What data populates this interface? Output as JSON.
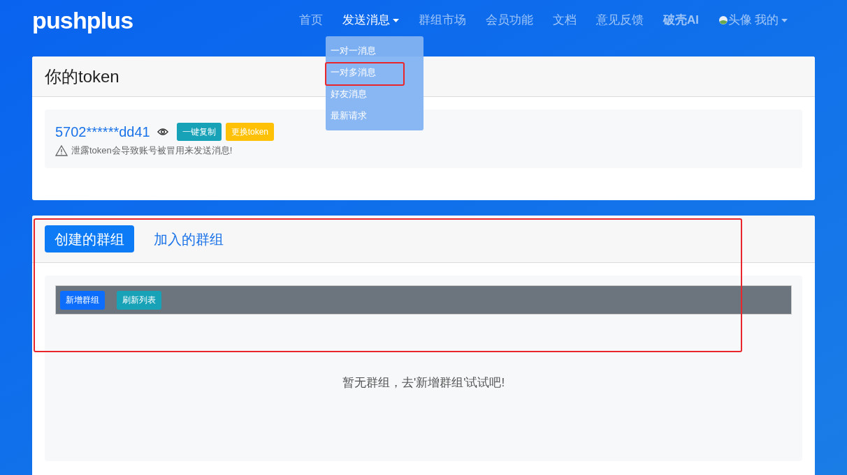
{
  "navbar": {
    "brand": "pushplus",
    "items": [
      {
        "label": "首页",
        "selected": false,
        "dropdown": false
      },
      {
        "label": "发送消息",
        "selected": true,
        "dropdown": true
      },
      {
        "label": "群组市场",
        "selected": false,
        "dropdown": false
      },
      {
        "label": "会员功能",
        "selected": false,
        "dropdown": false
      },
      {
        "label": "文档",
        "selected": false,
        "dropdown": false
      },
      {
        "label": "意见反馈",
        "selected": false,
        "dropdown": false
      },
      {
        "label": "破壳AI",
        "selected": false,
        "dropdown": false,
        "bold": true
      }
    ],
    "user": {
      "avatar_alt": "头像",
      "label": "我的"
    }
  },
  "dropdown_menu": [
    {
      "label": "一对一消息",
      "highlighted": false
    },
    {
      "label": "一对多消息",
      "highlighted": true
    },
    {
      "label": "好友消息",
      "highlighted": false
    },
    {
      "label": "最新请求",
      "highlighted": false
    }
  ],
  "token_card": {
    "title": "你的token",
    "token": "5702******dd41",
    "buttons": [
      {
        "label": "一键复制",
        "kind": "info"
      },
      {
        "label": "更换token",
        "kind": "warning"
      }
    ],
    "warning": "泄露token会导致账号被冒用来发送消息!"
  },
  "groups_card": {
    "highlighted": true,
    "tabs": [
      {
        "label": "创建的群组",
        "selected": true
      },
      {
        "label": "加入的群组",
        "selected": false
      }
    ],
    "toolbar_buttons": [
      {
        "label": "新增群组",
        "kind": "primary"
      },
      {
        "label": "刷新列表",
        "kind": "info"
      }
    ],
    "empty_message": "暂无群组，去'新增群组'试试吧!"
  }
}
